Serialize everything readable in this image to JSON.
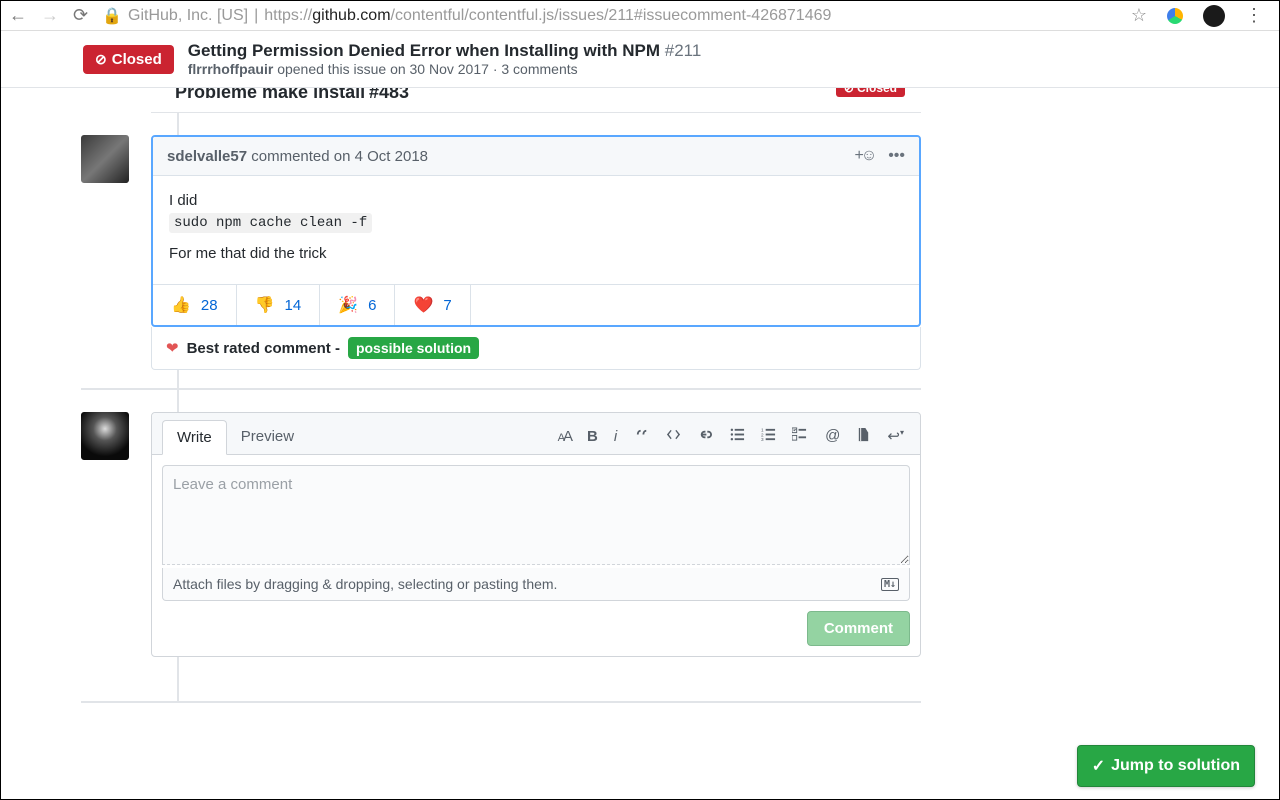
{
  "browser": {
    "org": "GitHub, Inc. [US]",
    "url_prefix": "https://",
    "url_domain": "github.com",
    "url_path": "/contentful/contentful.js/issues/211#issuecomment-426871469"
  },
  "issue": {
    "state": "Closed",
    "title": "Getting Permission Denied Error when Installing with NPM",
    "number": "#211",
    "author": "flrrrhoffpauir",
    "opened_text": "opened this issue",
    "date": "on 30 Nov 2017",
    "comments": "3 comments"
  },
  "related": {
    "title": "Probleme make install",
    "ref": "#483",
    "state": "Closed"
  },
  "comment": {
    "user": "sdelvalle57",
    "verb": "commented",
    "date": "on 4 Oct 2018",
    "body_line1": "I did",
    "body_code": "sudo npm cache clean -f",
    "body_line2": "For me that did the trick",
    "reactions": [
      {
        "emoji": "👍",
        "count": "28"
      },
      {
        "emoji": "👎",
        "count": "14"
      },
      {
        "emoji": "🎉",
        "count": "6"
      },
      {
        "emoji": "❤️",
        "count": "7"
      }
    ]
  },
  "best_rated": {
    "label": "Best rated comment -",
    "tag": "possible solution"
  },
  "composer": {
    "tab_write": "Write",
    "tab_preview": "Preview",
    "placeholder": "Leave a comment",
    "attach_hint": "Attach files by dragging & dropping, selecting or pasting them.",
    "md_badge": "M↓",
    "submit": "Comment"
  },
  "jump": {
    "label": "Jump to solution"
  }
}
